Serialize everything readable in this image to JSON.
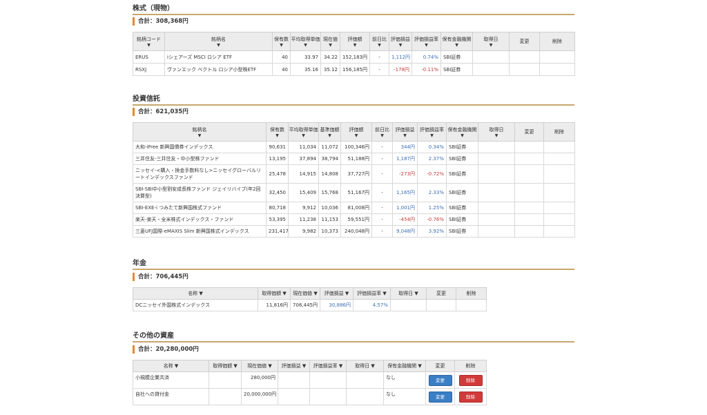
{
  "stocks": {
    "heading": "株式（現物）",
    "total": "合計：308,368円",
    "columns": [
      "銘柄コード",
      "銘柄名",
      "保有数",
      "平均取得単価",
      "現在値",
      "評価額",
      "前日比",
      "評価損益",
      "評価損益率",
      "保有金融機関",
      "取得日",
      "変更",
      "削除"
    ],
    "arrow": "▼",
    "rows": [
      {
        "code": "ERUS",
        "name": "iシェアーズ MSCI ロシア ETF",
        "qty": "40",
        "avg": "33.97",
        "price": "34.22",
        "value": "152,183円",
        "prev": "-",
        "pl": "1,112円",
        "plr": "0.74%",
        "inst": "SBI証券"
      },
      {
        "code": "RSXJ",
        "name": "ヴァンエック ベクトル ロシア小型株ETF",
        "qty": "40",
        "avg": "35.16",
        "price": "35.12",
        "value": "156,185円",
        "prev": "-",
        "pl": "-178円",
        "plr": "-0.11%",
        "inst": "SBI証券"
      }
    ]
  },
  "funds": {
    "heading": "投資信託",
    "total": "合計：621,035円",
    "columns": [
      "銘柄名",
      "保有数",
      "平均取得単価",
      "基準価額",
      "評価額",
      "前日比",
      "評価損益",
      "評価損益率",
      "保有金融機関",
      "取得日",
      "変更",
      "削除"
    ],
    "rows": [
      {
        "name": "大和-iFree 新興国債券インデックス",
        "qty": "90,631",
        "avg": "11,034",
        "base": "11,072",
        "value": "100,346円",
        "prev": "-",
        "pl": "344円",
        "plr": "0.34%",
        "inst": "SBI証券"
      },
      {
        "name": "三井住友-三井住友・中小型株ファンド",
        "qty": "13,195",
        "avg": "37,894",
        "base": "38,794",
        "value": "51,188円",
        "prev": "-",
        "pl": "1,187円",
        "plr": "2.37%",
        "inst": "SBI証券"
      },
      {
        "name": "ニッセイ-<購入・換金手数料なし>ニッセイグローバルリートインデックスファンド",
        "qty": "25,478",
        "avg": "14,915",
        "base": "14,808",
        "value": "37,727円",
        "prev": "-",
        "pl": "-273円",
        "plr": "-0.72%",
        "inst": "SBI証券"
      },
      {
        "name": "SBI-SBI中小型割安成長株ファンド ジェイリバイブ(年2回決算型)",
        "qty": "32,450",
        "avg": "15,409",
        "base": "15,768",
        "value": "51,167円",
        "prev": "-",
        "pl": "1,165円",
        "plr": "2.33%",
        "inst": "SBI証券"
      },
      {
        "name": "SBI-EXE-i つみたて新興国株式ファンド",
        "qty": "80,718",
        "avg": "9,912",
        "base": "10,036",
        "value": "81,008円",
        "prev": "-",
        "pl": "1,001円",
        "plr": "1.25%",
        "inst": "SBI証券"
      },
      {
        "name": "楽天-楽天・全米株式インデックス・ファンド",
        "qty": "53,395",
        "avg": "11,238",
        "base": "11,153",
        "value": "59,551円",
        "prev": "-",
        "pl": "-454円",
        "plr": "-0.76%",
        "inst": "SBI証券"
      },
      {
        "name": "三菱UFJ国際-eMAXIS Slim 新興国株式インデックス",
        "qty": "231,417",
        "avg": "9,982",
        "base": "10,373",
        "value": "240,048円",
        "prev": "-",
        "pl": "9,048円",
        "plr": "3.92%",
        "inst": "SBI証券"
      }
    ]
  },
  "pension": {
    "heading": "年金",
    "total": "合計：706,445円",
    "columns": [
      "名称 ▼",
      "取得価額 ▼",
      "現在価値 ▼",
      "評価損益 ▼",
      "評価損益率 ▼",
      "取得日 ▼",
      "変更",
      "削除"
    ],
    "rows": [
      {
        "name": "DCニッセイ外国株式インデックス",
        "cost": "11,816円",
        "current": "706,445円",
        "pl": "30,886円",
        "plr": "4.57%"
      }
    ]
  },
  "other": {
    "heading": "その他の資産",
    "total": "合計：20,280,000円",
    "columns": [
      "名称 ▼",
      "取得価額 ▼",
      "現在価値 ▼",
      "評価損益 ▼",
      "評価損益率 ▼",
      "取得日 ▼",
      "保有金融機関 ▼",
      "変更",
      "削除"
    ],
    "edit_label": "変更",
    "delete_label": "削除",
    "rows": [
      {
        "name": "小規模企業共済",
        "current": "280,000円",
        "inst": "なし"
      },
      {
        "name": "自社への貸付金",
        "current": "20,000,000円",
        "inst": "なし"
      }
    ]
  },
  "colors": {
    "accent_line": "#c8a56b",
    "total_bar": "#e28a2c",
    "positive": "#3a6db5",
    "negative": "#c03a3a",
    "edit_button": "#3a7ec4",
    "delete_button": "#d23a3a"
  }
}
